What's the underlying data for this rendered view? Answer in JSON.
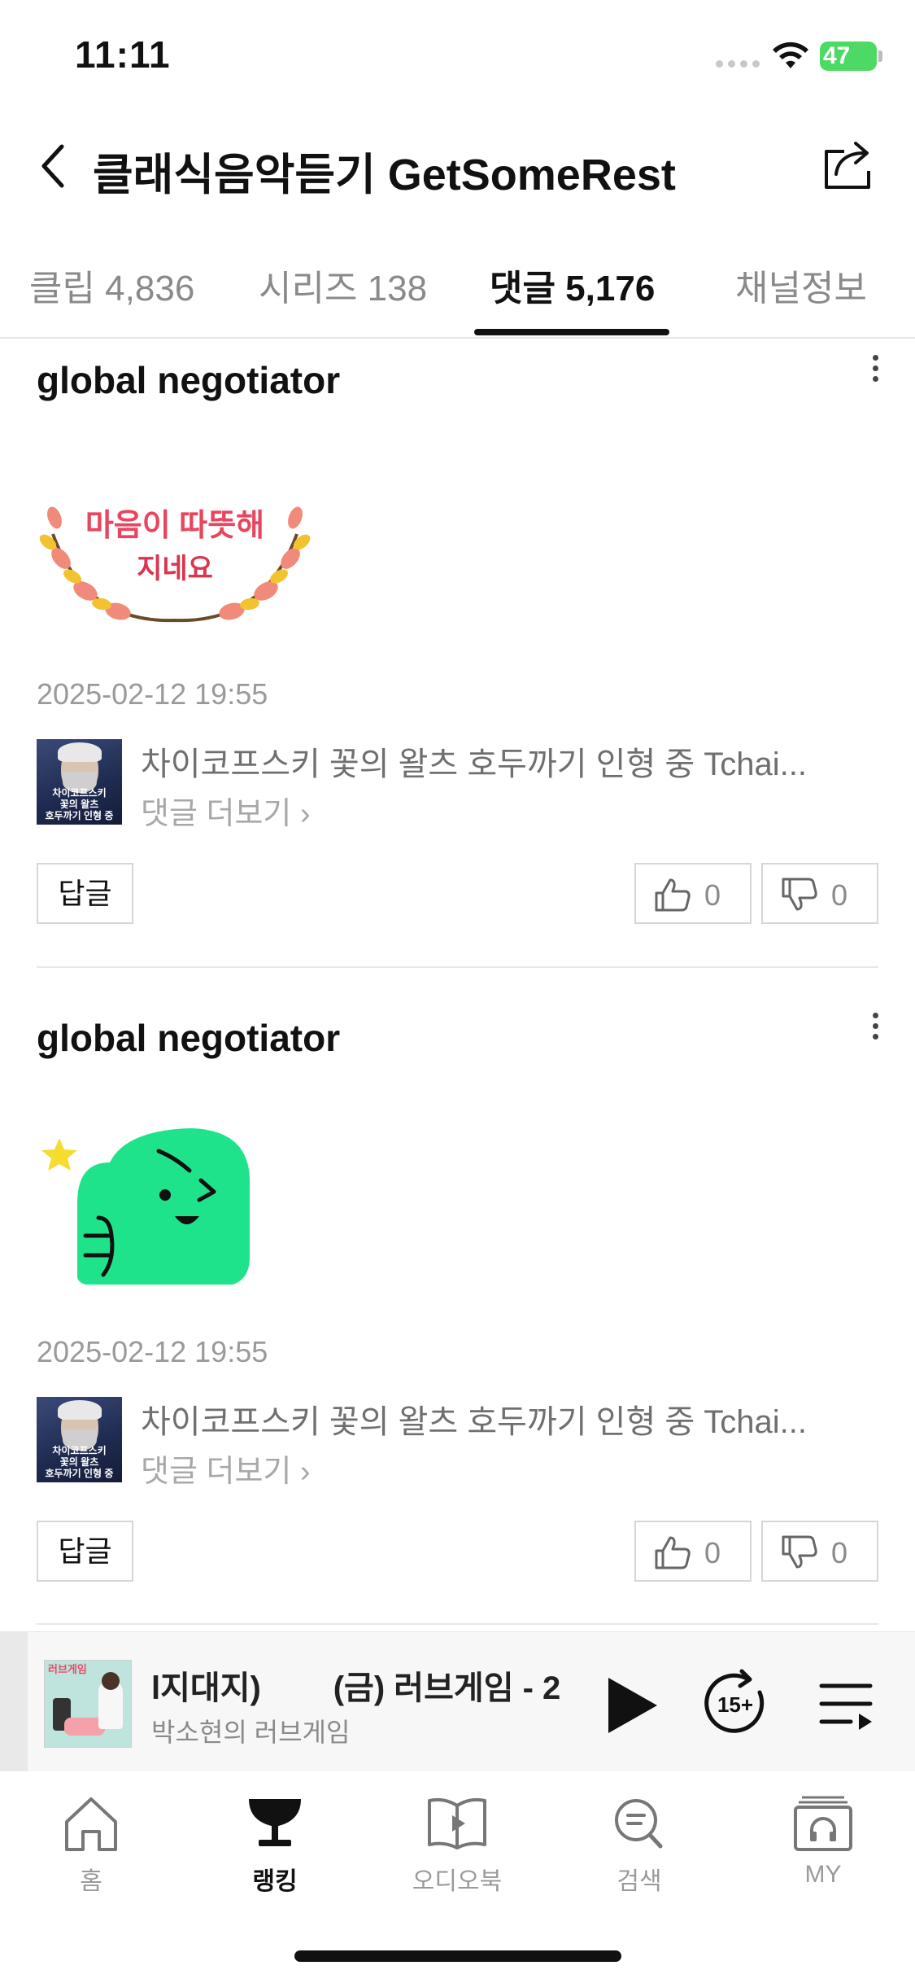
{
  "status_bar": {
    "time": "11:11",
    "battery": "47"
  },
  "header": {
    "title": "클래식음악듣기 GetSomeRest"
  },
  "tabs": [
    {
      "label": "클립 4,836",
      "active": false
    },
    {
      "label": "시리즈 138",
      "active": false
    },
    {
      "label": "댓글 5,176",
      "active": true
    },
    {
      "label": "채널정보",
      "active": false
    }
  ],
  "comments": [
    {
      "author": "global negotiator",
      "sticker": "warm-heart-wreath-sticker",
      "sticker_text": [
        "마음이 따뜻해",
        "지네요"
      ],
      "date": "2025-02-12 19:55",
      "thumb_text": [
        "차이코프스키",
        "꽃의 왈츠",
        "호두까기 인형 중"
      ],
      "series_title": "차이코프스키 꽃의 왈츠 호두까기 인형 중 Tchai...",
      "see_more": "댓글 더보기",
      "reply_label": "답글",
      "likes": "0",
      "dislikes": "0"
    },
    {
      "author": "global negotiator",
      "sticker": "green-thumbs-up-character-sticker",
      "date": "2025-02-12 19:55",
      "thumb_text": [
        "차이코프스키",
        "꽃의 왈츠",
        "호두까기 인형 중"
      ],
      "series_title": "차이코프스키 꽃의 왈츠 호두까기 인형 중 Tchai...",
      "see_more": "댓글 더보기",
      "reply_label": "답글",
      "likes": "0",
      "dislikes": "0"
    }
  ],
  "mini_player": {
    "title": "l지대지)        (금) 러브게임 - 2",
    "subtitle": "박소현의 러브게임",
    "thumb_text": "러브게임",
    "skip_label": "15+"
  },
  "bottom_nav": [
    {
      "label": "홈",
      "icon": "home-icon",
      "active": false
    },
    {
      "label": "랭킹",
      "icon": "trophy-icon",
      "active": true
    },
    {
      "label": "오디오북",
      "icon": "audiobook-icon",
      "active": false
    },
    {
      "label": "검색",
      "icon": "search-icon",
      "active": false
    },
    {
      "label": "MY",
      "icon": "my-headphones-icon",
      "active": false
    }
  ],
  "colors": {
    "accent_text": "#111111",
    "muted_text": "#8a8a8a",
    "battery": "#4cd964",
    "sticker_green": "#1fe38a"
  }
}
